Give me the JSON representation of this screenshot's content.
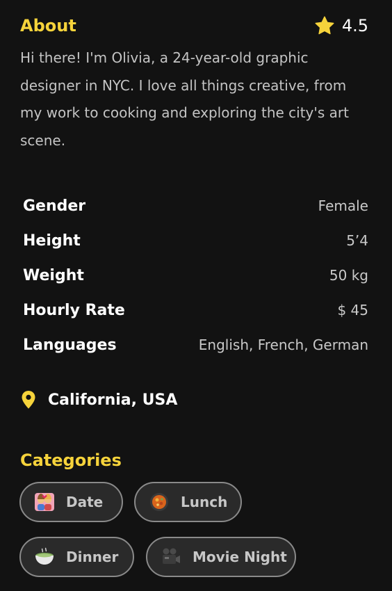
{
  "about": {
    "title": "About",
    "rating": "4.5",
    "bio": "Hi there! I'm Olivia, a 24-year-old graphic designer in NYC. I love all things creative, from my work to cooking and exploring the city's art scene."
  },
  "details": [
    {
      "label": "Gender",
      "value": "Female"
    },
    {
      "label": "Height",
      "value": "5’4"
    },
    {
      "label": "Weight",
      "value": "50 kg"
    },
    {
      "label": "Hourly Rate",
      "value": "$ 45"
    },
    {
      "label": "Languages",
      "value": "English, French, German"
    }
  ],
  "location": {
    "text": "California, USA",
    "icon": "map-pin-icon"
  },
  "categories": {
    "title": "Categories",
    "items": [
      {
        "label": "Date",
        "icon": "couple-icon"
      },
      {
        "label": "Lunch",
        "icon": "pan-food-icon"
      },
      {
        "label": "Dinner",
        "icon": "bowl-icon"
      },
      {
        "label": "Movie Night",
        "icon": "movie-camera-icon"
      }
    ]
  },
  "colors": {
    "background": "#121212",
    "accent": "#f6d33b",
    "chip_border": "#8a8a8a"
  }
}
